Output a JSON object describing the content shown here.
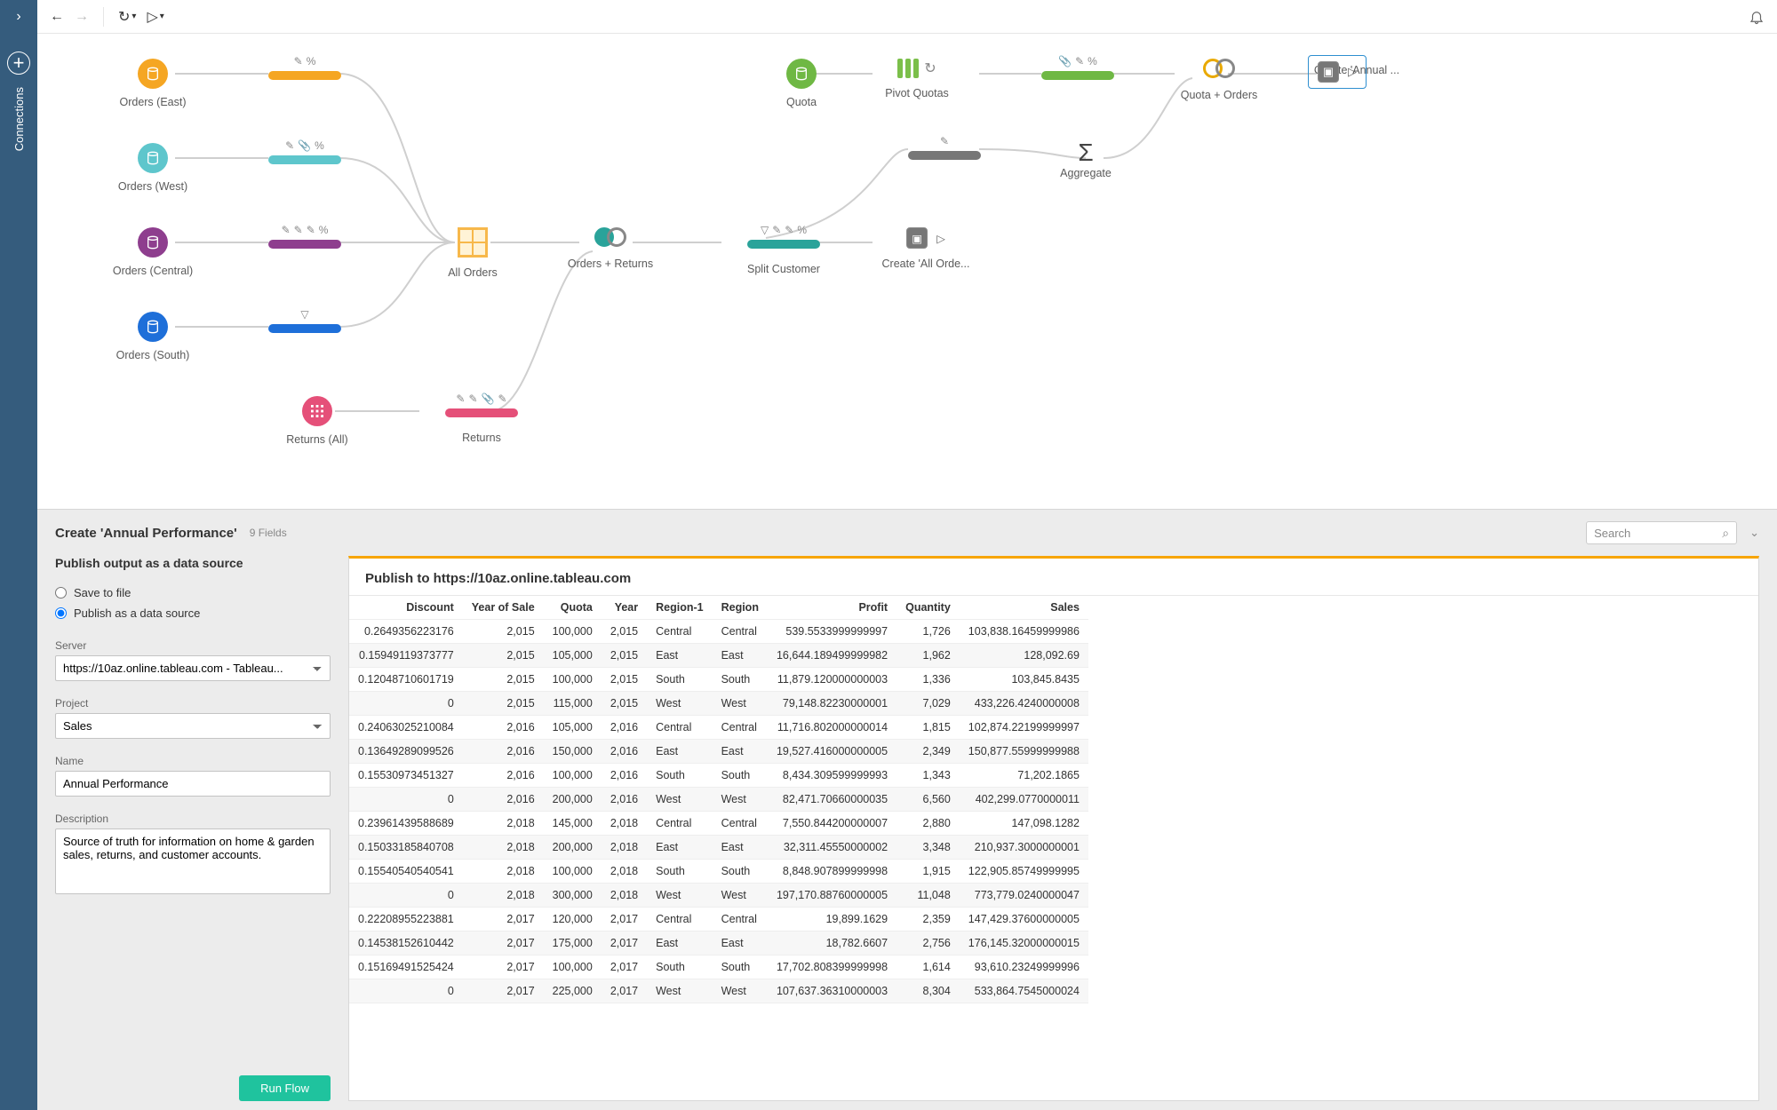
{
  "sidebar": {
    "label": "Connections"
  },
  "toolbar": {
    "back": "←",
    "fwd": "→",
    "refresh": "↻",
    "run": "▷"
  },
  "flow": {
    "inputs": {
      "east": {
        "label": "Orders (East)",
        "color": "#f5a623"
      },
      "west": {
        "label": "Orders (West)",
        "color": "#5ec6cc"
      },
      "central": {
        "label": "Orders (Central)",
        "color": "#8e3e8e"
      },
      "south": {
        "label": "Orders (South)",
        "color": "#1e6fd9"
      },
      "returns": {
        "label": "Returns (All)",
        "color": "#e55079"
      },
      "quota": {
        "label": "Quota",
        "color": "#6fb844"
      }
    },
    "steps": {
      "all_orders": {
        "label": "All Orders"
      },
      "orders_returns": {
        "label": "Orders + Returns"
      },
      "returns_clean": {
        "label": "Returns"
      },
      "split_customer": {
        "label": "Split Customer"
      },
      "pivot_quotas": {
        "label": "Pivot Quotas"
      },
      "aggregate": {
        "label": "Aggregate"
      },
      "quota_orders": {
        "label": "Quota + Orders"
      }
    },
    "outputs": {
      "all_orders": {
        "label": "Create 'All Orde..."
      },
      "annual": {
        "label": "Create 'Annual ..."
      }
    }
  },
  "pane": {
    "title": "Create 'Annual Performance'",
    "fields_count": "9 Fields",
    "search_placeholder": "Search"
  },
  "settings": {
    "heading": "Publish output as a data source",
    "save_to_file": "Save to file",
    "publish_as_ds": "Publish as a data source",
    "server_label": "Server",
    "server_value": "https://10az.online.tableau.com - Tableau...",
    "project_label": "Project",
    "project_value": "Sales",
    "name_label": "Name",
    "name_value": "Annual Performance",
    "description_label": "Description",
    "description_value": "Source of truth for information on home & garden sales, returns, and customer accounts.",
    "run_flow": "Run Flow"
  },
  "preview": {
    "title": "Publish to https://10az.online.tableau.com",
    "columns": [
      "Discount",
      "Year of Sale",
      "Quota",
      "Year",
      "Region-1",
      "Region",
      "Profit",
      "Quantity",
      "Sales"
    ],
    "col_numeric": [
      true,
      true,
      true,
      true,
      false,
      false,
      true,
      true,
      true
    ],
    "rows": [
      [
        "0.2649356223176",
        "2,015",
        "100,000",
        "2,015",
        "Central",
        "Central",
        "539.5533999999997",
        "1,726",
        "103,838.16459999986"
      ],
      [
        "0.15949119373777",
        "2,015",
        "105,000",
        "2,015",
        "East",
        "East",
        "16,644.189499999982",
        "1,962",
        "128,092.69"
      ],
      [
        "0.12048710601719",
        "2,015",
        "100,000",
        "2,015",
        "South",
        "South",
        "11,879.120000000003",
        "1,336",
        "103,845.8435"
      ],
      [
        "0",
        "2,015",
        "115,000",
        "2,015",
        "West",
        "West",
        "79,148.82230000001",
        "7,029",
        "433,226.4240000008"
      ],
      [
        "0.24063025210084",
        "2,016",
        "105,000",
        "2,016",
        "Central",
        "Central",
        "11,716.802000000014",
        "1,815",
        "102,874.22199999997"
      ],
      [
        "0.13649289099526",
        "2,016",
        "150,000",
        "2,016",
        "East",
        "East",
        "19,527.416000000005",
        "2,349",
        "150,877.55999999988"
      ],
      [
        "0.15530973451327",
        "2,016",
        "100,000",
        "2,016",
        "South",
        "South",
        "8,434.309599999993",
        "1,343",
        "71,202.1865"
      ],
      [
        "0",
        "2,016",
        "200,000",
        "2,016",
        "West",
        "West",
        "82,471.70660000035",
        "6,560",
        "402,299.0770000011"
      ],
      [
        "0.23961439588689",
        "2,018",
        "145,000",
        "2,018",
        "Central",
        "Central",
        "7,550.844200000007",
        "2,880",
        "147,098.1282"
      ],
      [
        "0.15033185840708",
        "2,018",
        "200,000",
        "2,018",
        "East",
        "East",
        "32,311.45550000002",
        "3,348",
        "210,937.3000000001"
      ],
      [
        "0.15540540540541",
        "2,018",
        "100,000",
        "2,018",
        "South",
        "South",
        "8,848.907899999998",
        "1,915",
        "122,905.85749999995"
      ],
      [
        "0",
        "2,018",
        "300,000",
        "2,018",
        "West",
        "West",
        "197,170.88760000005",
        "11,048",
        "773,779.0240000047"
      ],
      [
        "0.22208955223881",
        "2,017",
        "120,000",
        "2,017",
        "Central",
        "Central",
        "19,899.1629",
        "2,359",
        "147,429.37600000005"
      ],
      [
        "0.14538152610442",
        "2,017",
        "175,000",
        "2,017",
        "East",
        "East",
        "18,782.6607",
        "2,756",
        "176,145.32000000015"
      ],
      [
        "0.15169491525424",
        "2,017",
        "100,000",
        "2,017",
        "South",
        "South",
        "17,702.808399999998",
        "1,614",
        "93,610.23249999996"
      ],
      [
        "0",
        "2,017",
        "225,000",
        "2,017",
        "West",
        "West",
        "107,637.36310000003",
        "8,304",
        "533,864.7545000024"
      ]
    ]
  }
}
